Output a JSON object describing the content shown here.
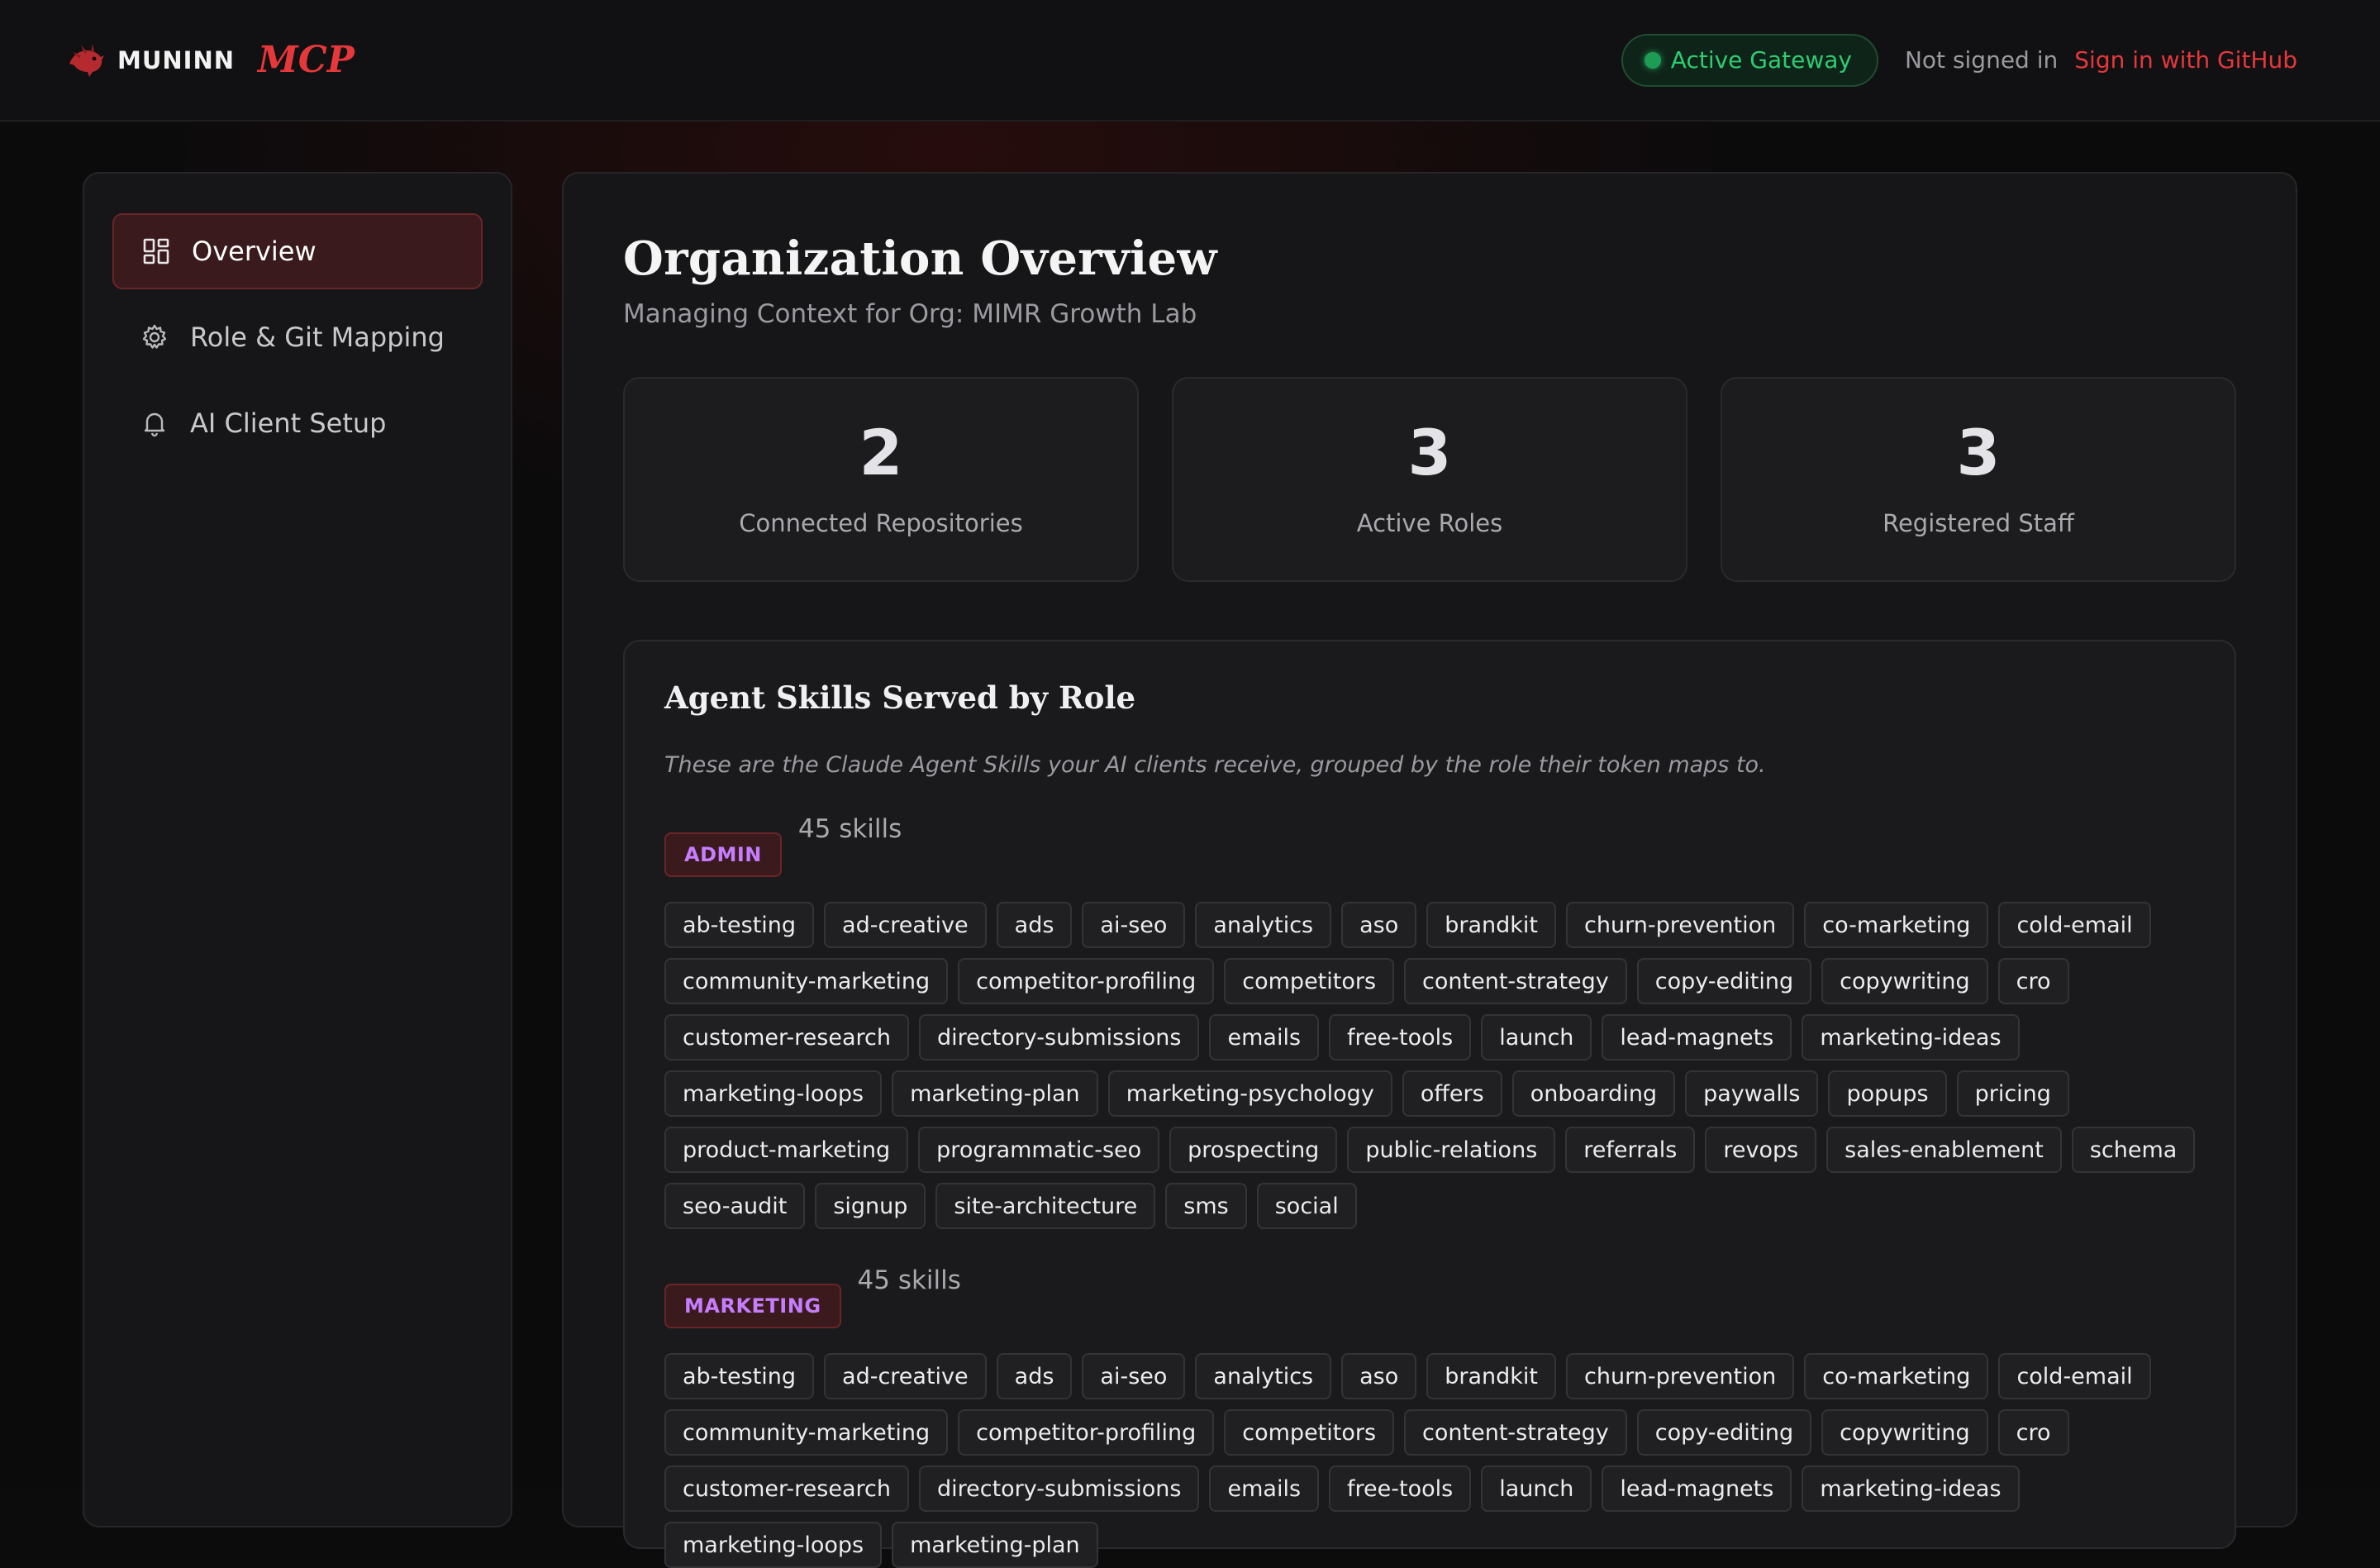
{
  "header": {
    "brand_name": "MUNINN",
    "brand_suffix": "MCP",
    "gateway_status": "Active Gateway",
    "auth_status": "Not signed in",
    "signin_label": "Sign in with GitHub"
  },
  "sidebar": {
    "items": [
      {
        "label": "Overview",
        "icon": "grid-icon",
        "active": true
      },
      {
        "label": "Role & Git Mapping",
        "icon": "gear-icon",
        "active": false
      },
      {
        "label": "AI Client Setup",
        "icon": "bell-icon",
        "active": false
      }
    ]
  },
  "main": {
    "title": "Organization Overview",
    "subtitle": "Managing Context for Org: MIMR Growth Lab",
    "stats": [
      {
        "value": "2",
        "label": "Connected Repositories"
      },
      {
        "value": "3",
        "label": "Active Roles"
      },
      {
        "value": "3",
        "label": "Registered Staff"
      }
    ],
    "skills": {
      "title": "Agent Skills Served by Role",
      "description": "These are the Claude Agent Skills your AI clients receive, grouped by the role their token maps to.",
      "roles": [
        {
          "name": "ADMIN",
          "count": "45 skills",
          "skills": [
            "ab-testing",
            "ad-creative",
            "ads",
            "ai-seo",
            "analytics",
            "aso",
            "brandkit",
            "churn-prevention",
            "co-marketing",
            "cold-email",
            "community-marketing",
            "competitor-profiling",
            "competitors",
            "content-strategy",
            "copy-editing",
            "copywriting",
            "cro",
            "customer-research",
            "directory-submissions",
            "emails",
            "free-tools",
            "launch",
            "lead-magnets",
            "marketing-ideas",
            "marketing-loops",
            "marketing-plan",
            "marketing-psychology",
            "offers",
            "onboarding",
            "paywalls",
            "popups",
            "pricing",
            "product-marketing",
            "programmatic-seo",
            "prospecting",
            "public-relations",
            "referrals",
            "revops",
            "sales-enablement",
            "schema",
            "seo-audit",
            "signup",
            "site-architecture",
            "sms",
            "social"
          ]
        },
        {
          "name": "MARKETING",
          "count": "45 skills",
          "skills": [
            "ab-testing",
            "ad-creative",
            "ads",
            "ai-seo",
            "analytics",
            "aso",
            "brandkit",
            "churn-prevention",
            "co-marketing",
            "cold-email",
            "community-marketing",
            "competitor-profiling",
            "competitors",
            "content-strategy",
            "copy-editing",
            "copywriting",
            "cro",
            "customer-research",
            "directory-submissions",
            "emails",
            "free-tools",
            "launch",
            "lead-magnets",
            "marketing-ideas",
            "marketing-loops",
            "marketing-plan"
          ]
        }
      ]
    }
  },
  "colors": {
    "accent": "#e5383b",
    "gateway_green": "#2ecc71",
    "role_badge_text": "#c77dff"
  }
}
